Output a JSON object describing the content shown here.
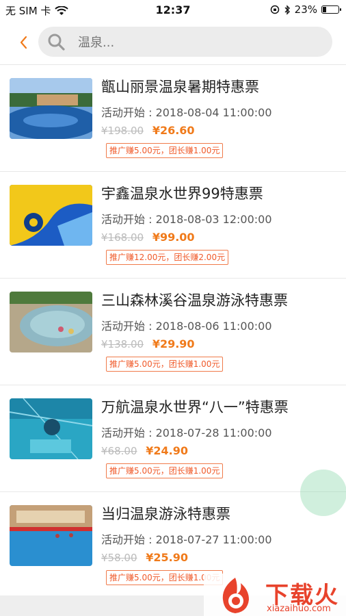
{
  "status_bar": {
    "carrier": "无 SIM 卡",
    "time": "12:37",
    "battery": "23%",
    "battery_level": 0.23
  },
  "header": {
    "search_placeholder": "温泉..."
  },
  "products": [
    {
      "title": "甑山丽景温泉暑期特惠票",
      "start": "活动开始 : 2018-08-04 11:00:00",
      "original_price": "¥198.00",
      "price": "¥26.60",
      "commission": "推广赚5.00元，团长赚1.00元"
    },
    {
      "title": "宇鑫温泉水世界99特惠票",
      "start": "活动开始 : 2018-08-03 12:00:00",
      "original_price": "¥168.00",
      "price": "¥99.00",
      "commission": "推广赚12.00元，团长赚2.00元"
    },
    {
      "title": "三山森林溪谷温泉游泳特惠票",
      "start": "活动开始 : 2018-08-06 11:00:00",
      "original_price": "¥138.00",
      "price": "¥29.90",
      "commission": "推广赚5.00元，团长赚1.00元"
    },
    {
      "title": "万航温泉水世界“八一”特惠票",
      "start": "活动开始 : 2018-07-28 11:00:00",
      "original_price": "¥68.00",
      "price": "¥24.90",
      "commission": "推广赚5.00元，团长赚1.00元"
    },
    {
      "title": "当归温泉游泳特惠票",
      "start": "活动开始 : 2018-07-27 11:00:00",
      "original_price": "¥58.00",
      "price": "¥25.90",
      "commission": "推广赚5.00元，团长赚1.00元"
    }
  ],
  "watermark": {
    "text": "下载火",
    "sub": "xiazaihuo.com"
  },
  "colors": {
    "accent": "#f07a1a",
    "commission_border": "#f07a4a"
  }
}
